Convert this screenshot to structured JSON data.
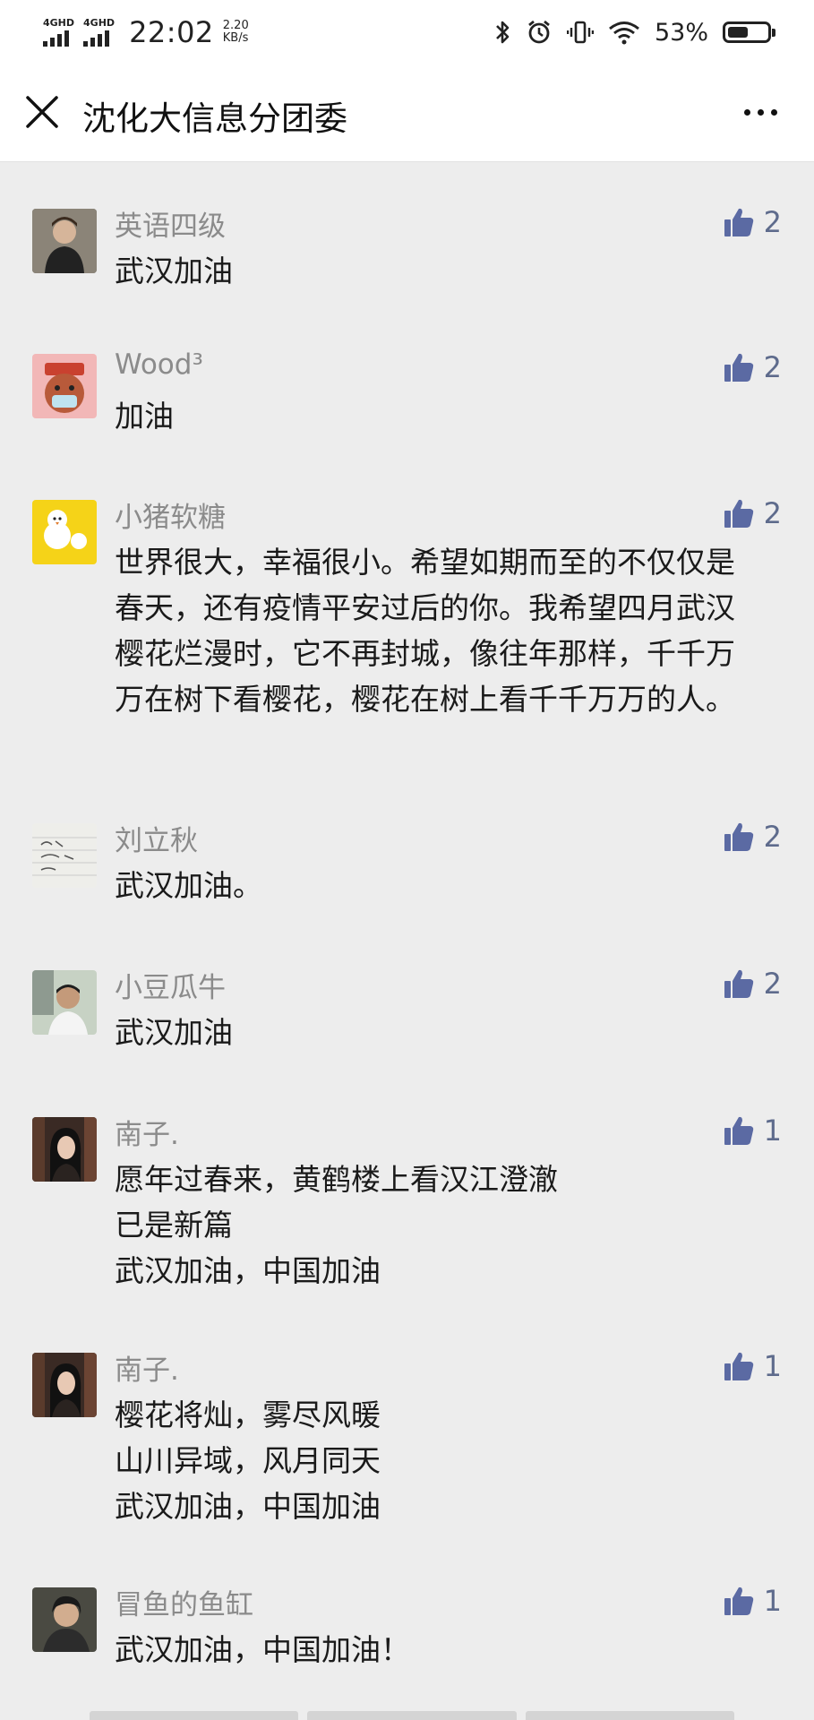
{
  "status_bar": {
    "signal_1": "4GHD",
    "signal_2": "4GHD",
    "time": "22:02",
    "speed_value": "2.20",
    "speed_unit": "KB/s",
    "battery_percent": "53%",
    "battery_level": 0.53
  },
  "nav": {
    "title": "沈化大信息分团委",
    "close_icon": "close-icon",
    "more_icon": "more-icon"
  },
  "comments": [
    {
      "name": "英语四级",
      "text": "武汉加油",
      "likes": "2",
      "avatar": "avatar-young-man"
    },
    {
      "name": "Wood³",
      "text": "加油",
      "likes": "2",
      "avatar": "avatar-cartoon-masked"
    },
    {
      "name": "小猪软糖",
      "text": "世界很大，幸福很小。希望如期而至的不仅仅是春天，还有疫情平安过后的你。我希望四月武汉樱花烂漫时，它不再封城，像往年那样，千千万万在树下看樱花，樱花在树上看千千万万的人。",
      "likes": "2",
      "avatar": "avatar-yellow-chick"
    },
    {
      "name": "刘立秋",
      "text": "武汉加油。",
      "likes": "2",
      "avatar": "avatar-handwritten-note"
    },
    {
      "name": "小豆瓜牛",
      "text": "武汉加油",
      "likes": "2",
      "avatar": "avatar-man-outdoors"
    },
    {
      "name": "南子.",
      "text": "愿年过春来，黄鹤楼上看汉江澄澈\n已是新篇\n武汉加油，中国加油",
      "likes": "1",
      "avatar": "avatar-woman-dark"
    },
    {
      "name": "南子.",
      "text": "樱花将灿，雾尽风暖\n山川异域，风月同天\n武汉加油，中国加油",
      "likes": "1",
      "avatar": "avatar-woman-dark"
    },
    {
      "name": "冒鱼的鱼缸",
      "text": "武汉加油，中国加油！",
      "likes": "1",
      "avatar": "avatar-man-portrait"
    }
  ],
  "colors": {
    "background": "#ededed",
    "like_icon": "#5b6aa3",
    "name_text": "#8b8b8b"
  }
}
